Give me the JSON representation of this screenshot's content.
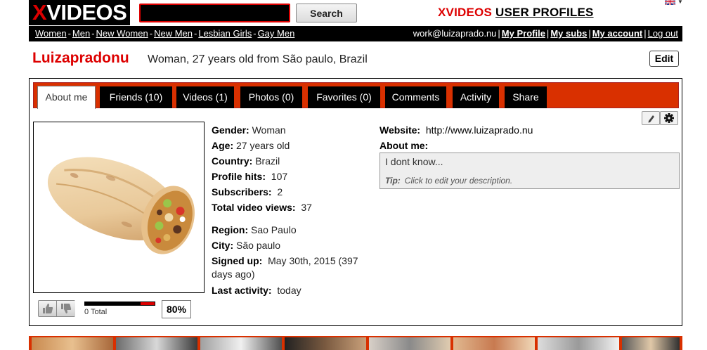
{
  "header": {
    "logo_x": "X",
    "logo_rest": "VIDEOS",
    "search_value": "",
    "search_button": "Search",
    "section_red": "XVIDEOS",
    "section_black": "USER PROFILES"
  },
  "nav": {
    "left": [
      "Women",
      "Men",
      "New Women",
      "New Men",
      "Lesbian Girls",
      "Gay Men"
    ],
    "email": "work@luizaprado.nu",
    "right": [
      "My Profile",
      "My subs",
      "My account",
      "Log out"
    ]
  },
  "profile": {
    "username": "Luizapradonu",
    "summary": "Woman, 27 years old from São paulo, Brazil",
    "edit_label": "Edit"
  },
  "tabs": [
    "About me",
    "Friends (10)",
    "Videos (1)",
    "Photos (0)",
    "Favorites (0)",
    "Comments",
    "Activity",
    "Share"
  ],
  "info": {
    "gender_label": "Gender:",
    "gender": "Woman",
    "age_label": "Age:",
    "age": "27 years old",
    "country_label": "Country:",
    "country": "Brazil",
    "hits_label": "Profile hits:",
    "hits": "107",
    "subs_label": "Subscribers:",
    "subs": "2",
    "views_label": "Total video views:",
    "views": "37",
    "region_label": "Region:",
    "region": "Sao Paulo",
    "city_label": "City:",
    "city": "São paulo",
    "signed_label": "Signed up:",
    "signed": "May 30th, 2015 (397 days ago)",
    "activity_label": "Last activity:",
    "activity": "today"
  },
  "about": {
    "website_label": "Website:",
    "website": "http://www.luizaprado.nu",
    "aboutme_label": "About me:",
    "description": "I dont know...",
    "tip_label": "Tip:",
    "tip": "Click to edit your description."
  },
  "rating": {
    "total": "0 Total",
    "percent_label": "80%",
    "positive_fraction": 0.8
  },
  "colors": {
    "brand_red": "#dd0000",
    "tab_bar": "#d93000"
  },
  "icons": [
    "uk-flag-icon",
    "pencil-icon",
    "gear-icon",
    "thumbs-up-icon",
    "thumbs-down-icon"
  ]
}
